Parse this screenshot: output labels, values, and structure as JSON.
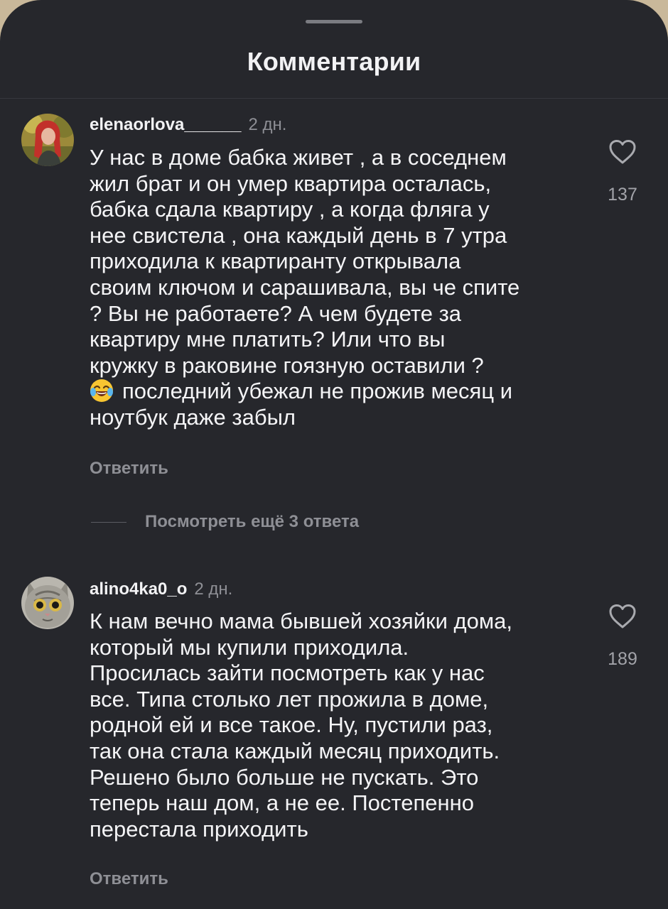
{
  "header": {
    "title": "Комментарии"
  },
  "comments": [
    {
      "username": "elenaorlova______",
      "time": "2 дн.",
      "lines": [
        "У нас в доме бабка живет , а в соседнем",
        "жил брат и он умер квартира осталась,",
        "бабка сдала квартиру , а когда фляга у",
        "нее свистела , она каждый день в 7 утра",
        "приходила к квартиранту открывала",
        "своим ключом и сарашивала, вы че спите",
        "? Вы не работаете? А чем будете за",
        "квартиру мне платить? Или что вы",
        "кружку в раковине гоязную оставили ?",
        "последний убежал не прожив месяц и",
        "ноутбук даже забыл"
      ],
      "emoji": "face-with-tears-of-joy",
      "likes": "137",
      "reply_label": "Ответить",
      "view_replies": "Посмотреть ещё 3 ответа"
    },
    {
      "username": "alino4ka0_o",
      "time": "2 дн.",
      "lines": [
        "К нам вечно мама бывшей хозяйки дома,",
        "который мы купили приходила.",
        "Просилась зайти посмотреть как у нас",
        "все. Типа столько лет прожила в доме,",
        "родной ей и все такое. Ну, пустили раз,",
        "так она стала каждый месяц приходить.",
        "Решено было больше не пускать. Это",
        "теперь наш дом, а не ее. Постепенно",
        "перестала приходить"
      ],
      "likes": "189",
      "reply_label": "Ответить"
    }
  ],
  "icons": {
    "like": "heart-outline-icon"
  },
  "colors": {
    "background": "#26272c",
    "text": "#f4f4f6",
    "muted": "#8e8f95"
  }
}
